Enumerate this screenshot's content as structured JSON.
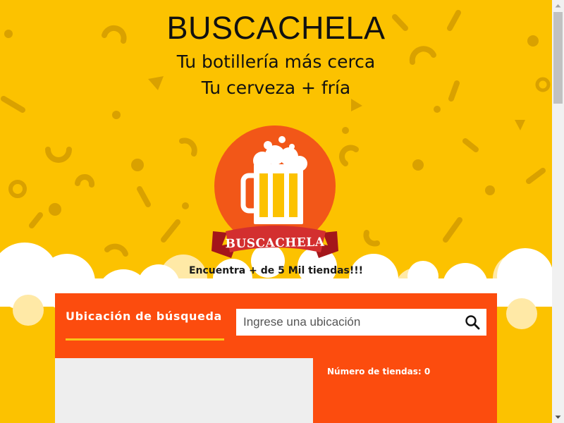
{
  "header": {
    "title": "BUSCACHELA",
    "tagline_1": "Tu botillería más cerca",
    "tagline_2": "Tu cerveza + fría"
  },
  "logo": {
    "banner_text": "BUSCACHELA",
    "icon": "beer-mug-icon"
  },
  "promo": {
    "text": "Encuentra + de 5 Mil tiendas!!!"
  },
  "search": {
    "label": "Ubicación de búsqueda",
    "placeholder": "Ingrese una ubicación",
    "button_icon": "search-icon"
  },
  "results": {
    "store_count": "Número de tiendas: 0"
  },
  "colors": {
    "background": "#fcc200",
    "accent_orange": "#fc4c0e",
    "logo_circle": "#f25718",
    "banner_red": "#d32f2f",
    "underline_yellow": "#f7c61a"
  }
}
